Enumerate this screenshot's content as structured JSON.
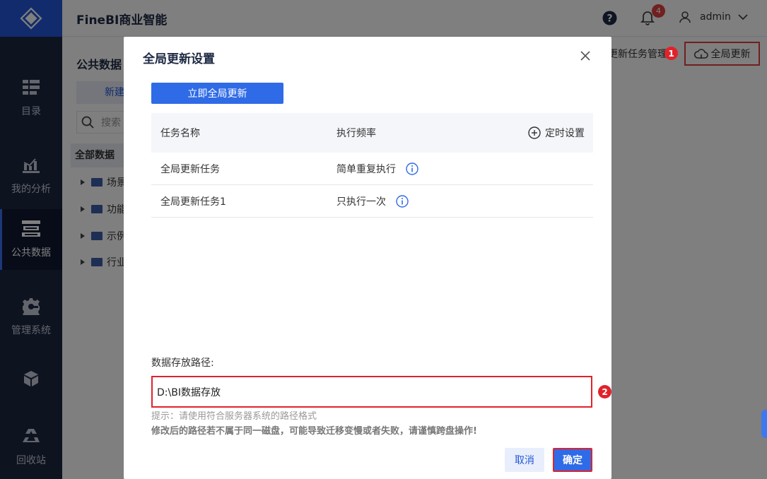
{
  "app": {
    "title": "FineBI商业智能"
  },
  "header": {
    "help_icon": "help-circle-icon",
    "notification_count": "4",
    "username": "admin"
  },
  "sidebar": {
    "items": [
      {
        "label": "目录",
        "icon": "catalog-icon"
      },
      {
        "label": "我的分析",
        "icon": "analysis-chart-icon"
      },
      {
        "label": "公共数据",
        "icon": "public-data-icon",
        "active": true
      },
      {
        "label": "管理系统",
        "icon": "gear-icon"
      },
      {
        "label": "",
        "icon": "cube-icon"
      },
      {
        "label": "回收站",
        "icon": "recycle-icon"
      }
    ]
  },
  "background": {
    "title": "公共数据",
    "new_button": "新建",
    "search_placeholder": "搜索",
    "all_data": "全部数据",
    "tree_items": [
      "场景",
      "功能",
      "示例",
      "行业"
    ],
    "task_manage": "更新任务管理",
    "global_update_button": "全局更新",
    "marker1": "1"
  },
  "dialog": {
    "title": "全局更新设置",
    "update_now_button": "立即全局更新",
    "table": {
      "headers": [
        "任务名称",
        "执行频率",
        "定时设置"
      ],
      "rows": [
        {
          "name": "全局更新任务",
          "frequency": "简单重复执行"
        },
        {
          "name": "全局更新任务1",
          "frequency": "只执行一次"
        }
      ]
    },
    "path_label": "数据存放路径:",
    "path_value": "D:\\BI数据存放",
    "hint1": "提示：请使用符合服务器系统的路径格式",
    "hint2": "修改后的路径若不属于同一磁盘，可能导致迁移变慢或者失败，请谨慎跨盘操作!",
    "cancel_button": "取消",
    "ok_button": "确定",
    "marker2": "2"
  },
  "colors": {
    "accent": "#2f6be6",
    "sidebar": "#1d2741",
    "annotation": "#e0232b"
  }
}
